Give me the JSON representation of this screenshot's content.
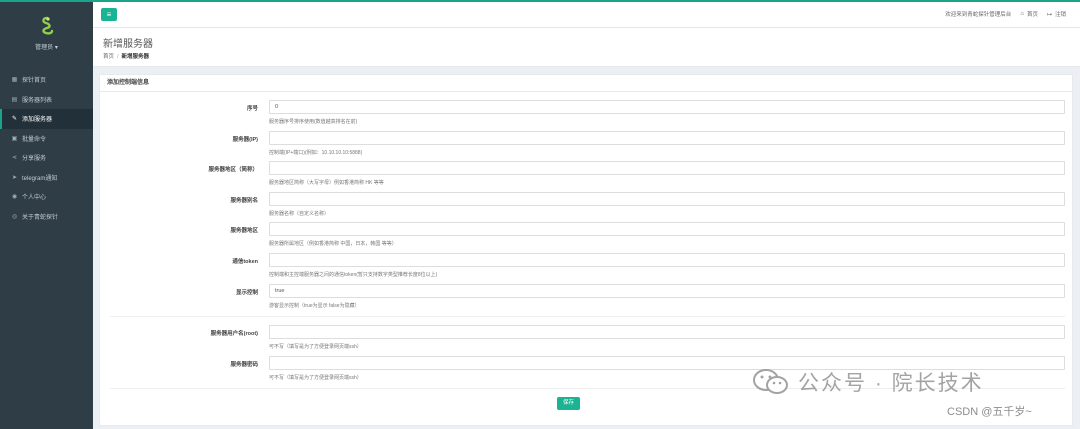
{
  "sidebar": {
    "user_label": "管理员 ▾",
    "items": [
      {
        "label": "探针首页",
        "icon": "dashboard-icon",
        "glyph": "▦"
      },
      {
        "label": "服务器列表",
        "icon": "server-list-icon",
        "glyph": "▤"
      },
      {
        "label": "添加服务器",
        "icon": "edit-icon",
        "glyph": "✎"
      },
      {
        "label": "批量命令",
        "icon": "terminal-icon",
        "glyph": "▣"
      },
      {
        "label": "分享服务",
        "icon": "share-icon",
        "glyph": "⋖"
      },
      {
        "label": "telegram通知",
        "icon": "send-icon",
        "glyph": "➤"
      },
      {
        "label": "个人中心",
        "icon": "user-icon",
        "glyph": "◉"
      },
      {
        "label": "关于青蛇探针",
        "icon": "eye-icon",
        "glyph": "◎"
      }
    ],
    "active_index": 2
  },
  "topbar": {
    "menu_glyph": "≡",
    "welcome": "欢迎来到青蛇探针管理后台",
    "home_label": "首页",
    "logout_label": "注销"
  },
  "header": {
    "title": "新增服务器",
    "breadcrumb_home": "首页",
    "breadcrumb_sep": "/",
    "breadcrumb_current": "新增服务器"
  },
  "panel": {
    "title": "添加控制端信息"
  },
  "form": {
    "seq_label": "序号",
    "seq_value": "0",
    "seq_help": "服务器序号排序使用(数值越高排名在前)",
    "ip_label": "服务器(IP)",
    "ip_value": "",
    "ip_help": "控制端(IP+端口)(例如：10.10.10.10:5888)",
    "region_short_label": "服务器地区（简称）",
    "region_short_value": "",
    "region_short_help": "服务器地区简称（大写字母）例如香港简称 HK 等等",
    "alias_label": "服务器别名",
    "alias_value": "",
    "alias_help": "服务器名称（自定义名称）",
    "region_label": "服务器地区",
    "region_value": "",
    "region_help": "服务器所属地区（例如香港简称 中国，日本，韩国 等等）",
    "token_label": "通信token",
    "token_value": "",
    "token_help": "控制端和主控端服务器之间的通信token(暂只支持数字类型推荐长度8位以上)",
    "display_label": "显示控制",
    "display_value": "true",
    "display_help": "游客显示控制（true为显示 false为隐藏）",
    "root_label": "服务器用户名(root)",
    "root_value": "",
    "root_help": "可不写（填写是为了方便登录网页端ssh）",
    "password_label": "服务器密码",
    "password_value": "",
    "password_help": "可不写（填写是为了方便登录网页端ssh）",
    "save_label": "保存"
  },
  "watermark": {
    "main": "公众号 · 院长技术",
    "sub": "CSDN @五千岁~"
  }
}
